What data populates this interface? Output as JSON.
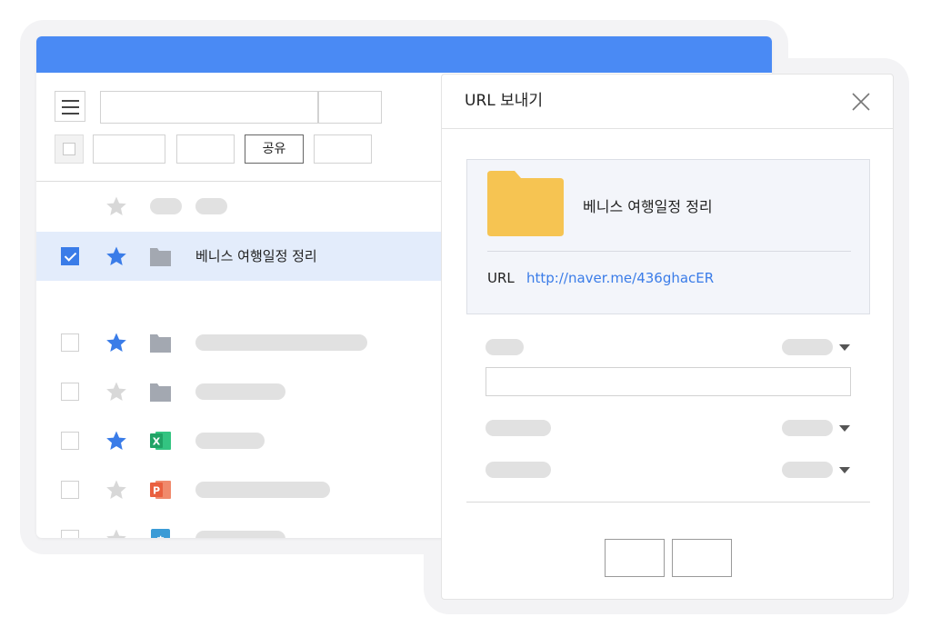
{
  "toolbar": {
    "share_label": "공유"
  },
  "file_list": {
    "rows": [
      {
        "checked": false,
        "starred": false,
        "icon": "folder-icon",
        "title": null
      },
      {
        "checked": true,
        "starred": true,
        "icon": "folder-icon",
        "title": "베니스 여행일정 정리"
      },
      {
        "checked": false,
        "starred": true,
        "icon": "folder-icon",
        "title": null
      },
      {
        "checked": false,
        "starred": false,
        "icon": "folder-icon",
        "title": null
      },
      {
        "checked": false,
        "starred": true,
        "icon": "excel-icon",
        "title": null,
        "icon_glyph": "X"
      },
      {
        "checked": false,
        "starred": false,
        "icon": "powerpoint-icon",
        "title": null,
        "icon_glyph": "P"
      },
      {
        "checked": false,
        "starred": false,
        "icon": "hwp-icon",
        "title": null,
        "icon_glyph": "ㅎ"
      }
    ]
  },
  "dialog": {
    "title": "URL 보내기",
    "item_name": "베니스 여행일정 정리",
    "url_label": "URL",
    "url_value": "http://naver.me/436ghacER"
  },
  "colors": {
    "accent": "#4a8af4",
    "star_on": "#3a7ce8",
    "star_off": "#d8d8d8",
    "folder_gray": "#a3a8b1",
    "folder_yellow": "#f6c452",
    "link": "#3a7ce8",
    "excel": "#21a366",
    "powerpoint": "#e9603f",
    "hwp": "#3b9bd6"
  }
}
